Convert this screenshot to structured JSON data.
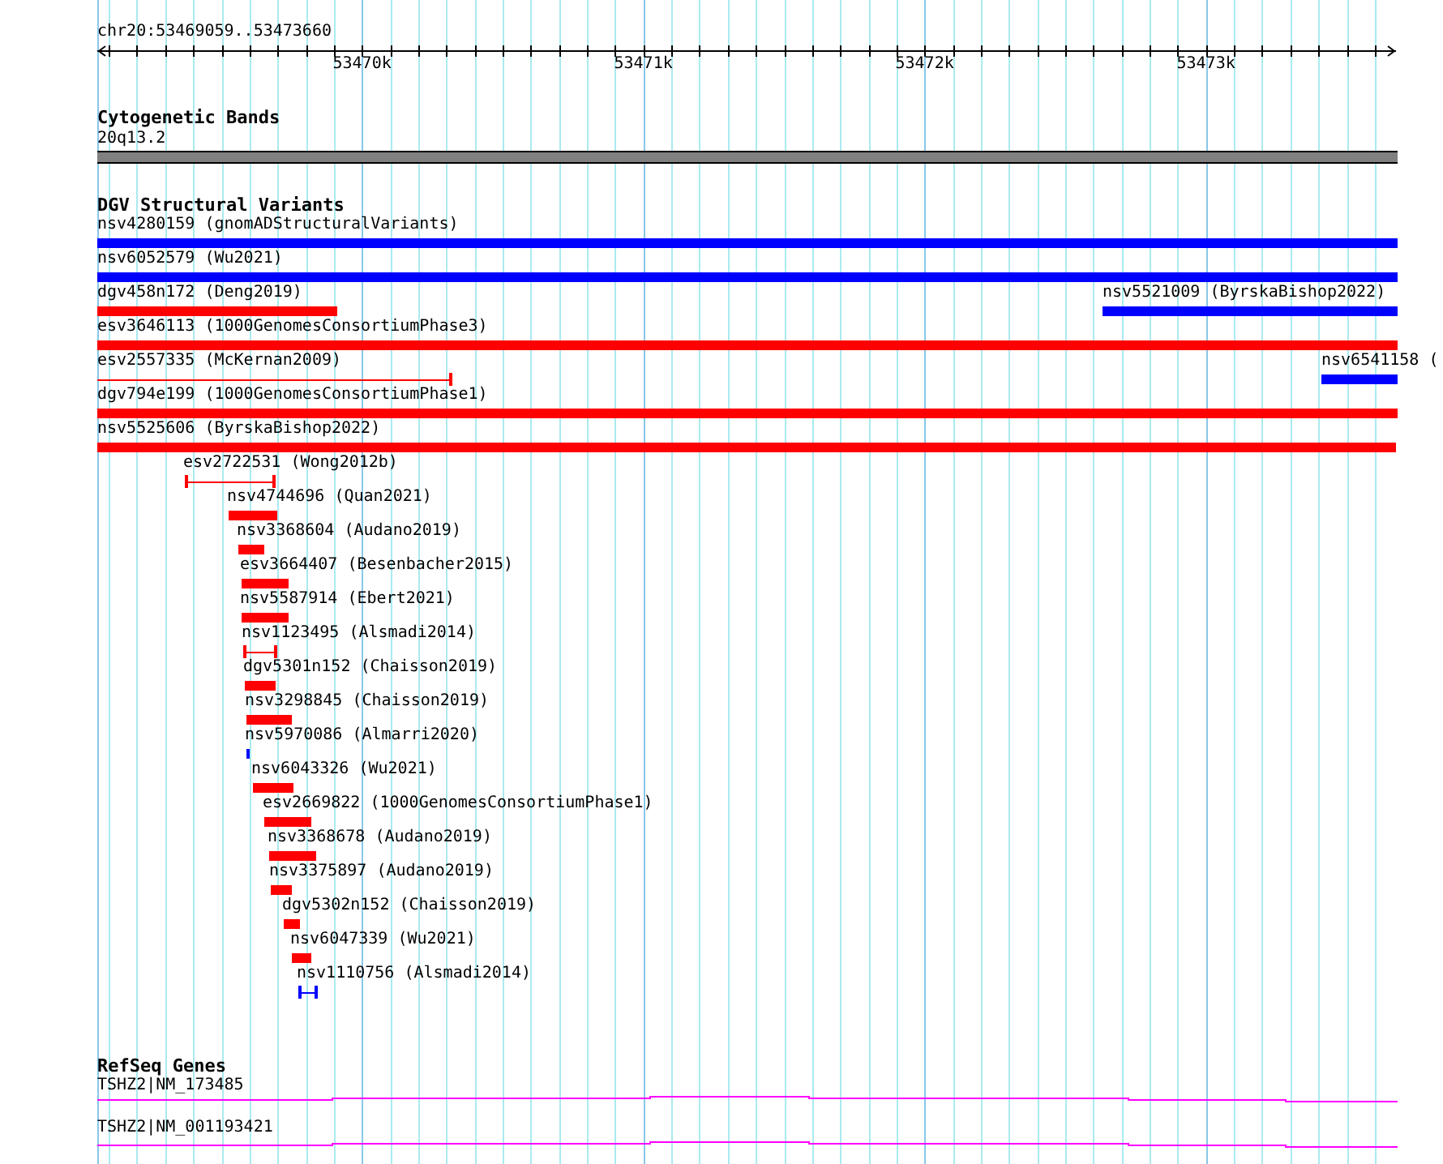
{
  "ruler": {
    "location": "chr20:53469059..53473660",
    "ticks": [
      "53470k",
      "53471k",
      "53472k",
      "53473k"
    ]
  },
  "tracks": [
    {
      "kind": "bands",
      "title": "Cytogenetic Bands",
      "features": [
        {
          "label": "20q13.2"
        }
      ]
    },
    {
      "kind": "variants",
      "title": "DGV Structural Variants",
      "features": [
        {
          "label": "nsv4280159 (gnomADStructuralVariants)",
          "kind": "bar",
          "color": "#0000ff"
        },
        {
          "label": "nsv6052579 (Wu2021)",
          "kind": "bar",
          "color": "#0000ff"
        },
        {
          "label": "dgv458n172 (Deng2019)",
          "kind": "bar",
          "color": "#ff0000"
        },
        {
          "label": "nsv5521009 (ByrskaBishop2022)",
          "kind": "bar",
          "color": "#0000ff"
        },
        {
          "label": "esv3646113 (1000GenomesConsortiumPhase3)",
          "kind": "bar",
          "color": "#ff0000"
        },
        {
          "label": "esv2557335 (McKernan2009)",
          "kind": "span",
          "color": "#ff0000"
        },
        {
          "label": "nsv6541158 (",
          "kind": "bar",
          "color": "#0000ff"
        },
        {
          "label": "dgv794e199 (1000GenomesConsortiumPhase1)",
          "kind": "bar",
          "color": "#ff0000"
        },
        {
          "label": "nsv5525606 (ByrskaBishop2022)",
          "kind": "bar",
          "color": "#ff0000"
        },
        {
          "label": "esv2722531 (Wong2012b)",
          "kind": "span",
          "color": "#ff0000"
        },
        {
          "label": "nsv4744696 (Quan2021)",
          "kind": "bar",
          "color": "#ff0000"
        },
        {
          "label": "nsv3368604 (Audano2019)",
          "kind": "bar",
          "color": "#ff0000"
        },
        {
          "label": "esv3664407 (Besenbacher2015)",
          "kind": "bar",
          "color": "#ff0000"
        },
        {
          "label": "nsv5587914 (Ebert2021)",
          "kind": "bar",
          "color": "#ff0000"
        },
        {
          "label": "nsv1123495 (Alsmadi2014)",
          "kind": "span",
          "color": "#ff0000"
        },
        {
          "label": "dgv5301n152 (Chaisson2019)",
          "kind": "bar",
          "color": "#ff0000"
        },
        {
          "label": "nsv3298845 (Chaisson2019)",
          "kind": "bar",
          "color": "#ff0000"
        },
        {
          "label": "nsv5970086 (Almarri2020)",
          "kind": "bar",
          "color": "#0000ff"
        },
        {
          "label": "nsv6043326 (Wu2021)",
          "kind": "bar",
          "color": "#ff0000"
        },
        {
          "label": "esv2669822 (1000GenomesConsortiumPhase1)",
          "kind": "bar",
          "color": "#ff0000"
        },
        {
          "label": "nsv3368678 (Audano2019)",
          "kind": "bar",
          "color": "#ff0000"
        },
        {
          "label": "nsv3375897 (Audano2019)",
          "kind": "bar",
          "color": "#ff0000"
        },
        {
          "label": "dgv5302n152 (Chaisson2019)",
          "kind": "bar",
          "color": "#ff0000"
        },
        {
          "label": "nsv6047339 (Wu2021)",
          "kind": "bar",
          "color": "#ff0000"
        },
        {
          "label": "nsv1110756 (Alsmadi2014)",
          "kind": "span",
          "color": "#0000ff"
        }
      ]
    },
    {
      "kind": "genes",
      "title": "RefSeq Genes",
      "features": [
        {
          "label": "TSHZ2|NM_173485"
        },
        {
          "label": "TSHZ2|NM_001193421"
        }
      ]
    }
  ]
}
